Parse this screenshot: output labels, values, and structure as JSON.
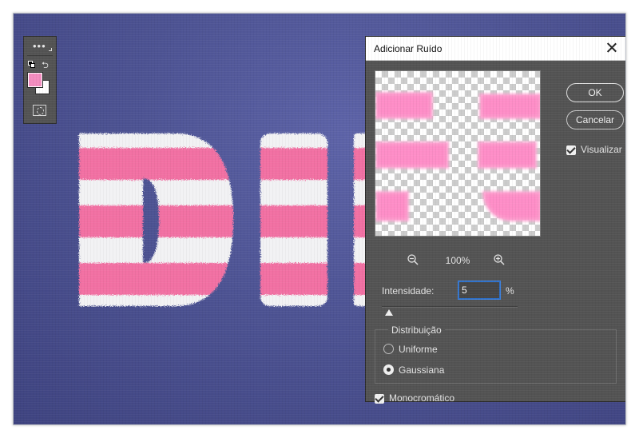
{
  "dialog": {
    "title": "Adicionar Ruído",
    "ok_label": "OK",
    "cancel_label": "Cancelar",
    "preview_label": "Visualizar",
    "preview_checked": true,
    "zoom_value": "100%",
    "intensity_label": "Intensidade:",
    "intensity_value": "5",
    "intensity_unit": "%",
    "intensity_slider_fraction": 0.05,
    "distribution": {
      "title": "Distribuição",
      "options": [
        {
          "label": "Uniforme",
          "selected": false
        },
        {
          "label": "Gaussiana",
          "selected": true
        }
      ]
    },
    "monochromatic_label": "Monocromático",
    "monochromatic_checked": true
  },
  "tools": {
    "foreground_color": "#f38cbf",
    "background_color": "#ffffff"
  },
  "canvas": {
    "background_color": "#4d5393",
    "stripe_pink": "#f26fa3",
    "stripe_white": "#f2f2f4"
  },
  "icons": [
    "more-icon",
    "default-colors-icon",
    "swap-colors-icon",
    "quick-mask-icon",
    "close-icon",
    "zoom-out-icon",
    "zoom-in-icon",
    "checkbox-icon"
  ]
}
